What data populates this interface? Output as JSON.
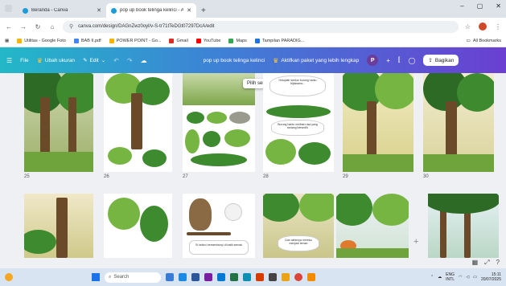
{
  "browser": {
    "tabs": [
      {
        "title": "Beranda - Canva",
        "active": false
      },
      {
        "title": "pop up book telinga kelinci - A",
        "active": true
      }
    ],
    "new_tab": "+",
    "window_controls": [
      "–",
      "▢",
      "✕"
    ],
    "url": "canva.com/design/DAGnZwz0oyl/v-S-tr71tTeDGt07297DcA/edit",
    "bookmarks": [
      {
        "label": "Utilitas - Google Foto",
        "color": "#f4b400"
      },
      {
        "label": "BAB II.pdf",
        "color": "#4285f4"
      },
      {
        "label": "POWER POINT - Go...",
        "color": "#f4b400"
      },
      {
        "label": "Gmail",
        "color": "#d93025"
      },
      {
        "label": "YouTube",
        "color": "#ff0000"
      },
      {
        "label": "Maps",
        "color": "#34a853"
      },
      {
        "label": "Tampilan PARADIG...",
        "color": "#1a73e8"
      }
    ],
    "all_bookmarks": "All Bookmarks"
  },
  "canva_toolbar": {
    "file": "File",
    "resize": "Ubah ukuran",
    "edit": "Edit",
    "design_title": "pop up book telinga kelinci",
    "upgrade": "Aktifkan paket yang lebih lengkap",
    "avatar_letter": "P",
    "share": "Bagikan"
  },
  "canvas": {
    "tooltip": "Pilih semua",
    "pages": [
      {
        "num": "25"
      },
      {
        "num": "26"
      },
      {
        "num": "27"
      },
      {
        "num": "28"
      },
      {
        "num": "29"
      },
      {
        "num": "30"
      }
    ],
    "note_text_1": "Hiduplah seekor burung hantu bijaksana...",
    "note_text_2": "Burung hantu melihat rusa yang sedang bersedih",
    "note_text_3": "Si kelinci bersembunyi di balik semak",
    "note_text_4": "Dan akhirnya mereka menjadi teman"
  },
  "taskbar": {
    "search": "Search",
    "lang": "ENG",
    "region": "INTL",
    "time": "15:11",
    "date": "20/07/2025"
  }
}
